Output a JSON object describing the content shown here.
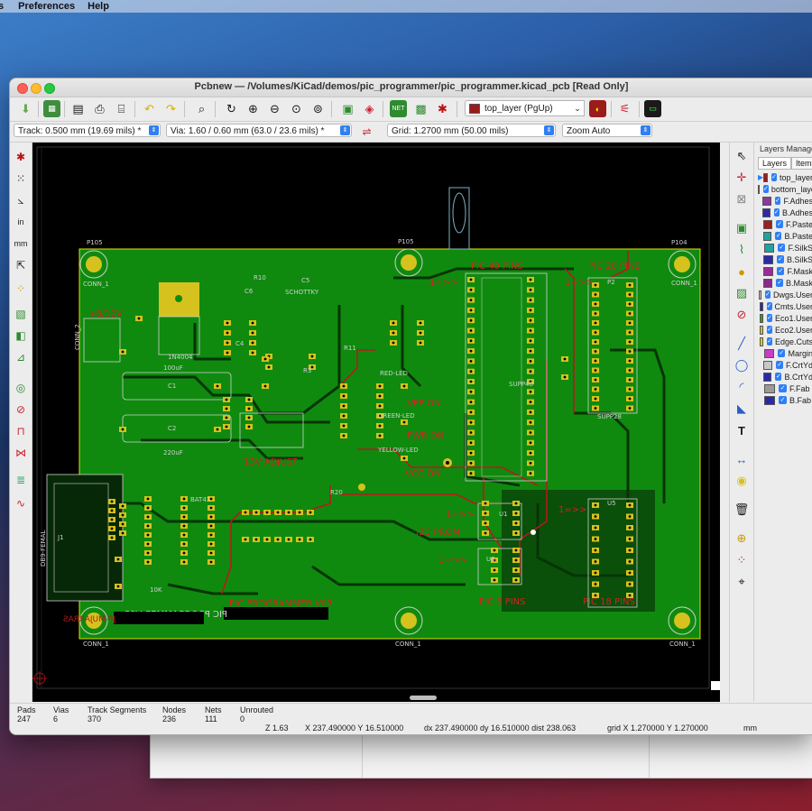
{
  "menubar": {
    "items": [
      "s",
      "Preferences",
      "Help"
    ]
  },
  "window": {
    "title": "Pcbnew — /Volumes/KiCad/demos/pic_programmer/pic_programmer.kicad_pcb [Read Only]"
  },
  "toolbar1": {
    "layer_select": "top_layer (PgUp)",
    "layer_color": "#9b1b1b"
  },
  "toolbar2": {
    "track": "Track: 0.500 mm (19.69 mils) *",
    "via": "Via: 1.60 / 0.60 mm (63.0 / 23.6 mils) *",
    "grid": "Grid: 1.2700 mm (50.00 mils)",
    "zoom": "Zoom Auto"
  },
  "layers_panel": {
    "title": "Layers Manager",
    "tab_layers": "Layers",
    "tab_items": "Items",
    "rows": [
      {
        "name": "top_layer",
        "color": "#9b1b1b",
        "active": true
      },
      {
        "name": "bottom_layer",
        "color": "#2e9e2e",
        "active": false
      },
      {
        "name": "F.Adhes",
        "color": "#8a3a9a",
        "active": false
      },
      {
        "name": "B.Adhes",
        "color": "#2a2aa8",
        "active": false
      },
      {
        "name": "F.Paste",
        "color": "#a01e1e",
        "active": false
      },
      {
        "name": "B.Paste",
        "color": "#1ea3a3",
        "active": false
      },
      {
        "name": "F.SilkS",
        "color": "#1ea3a3",
        "active": false
      },
      {
        "name": "B.SilkS",
        "color": "#2a2aa8",
        "active": false
      },
      {
        "name": "F.Mask",
        "color": "#9a2a9a",
        "active": false
      },
      {
        "name": "B.Mask",
        "color": "#8a2a8a",
        "active": false
      },
      {
        "name": "Dwgs.User",
        "color": "#c8c8c8",
        "active": false
      },
      {
        "name": "Cmts.User",
        "color": "#2a2aa8",
        "active": false
      },
      {
        "name": "Eco1.User",
        "color": "#2e9e2e",
        "active": false
      },
      {
        "name": "Eco2.User",
        "color": "#d6c21e",
        "active": false
      },
      {
        "name": "Edge.Cuts",
        "color": "#d6d61e",
        "active": false
      },
      {
        "name": "Margin",
        "color": "#c83cc8",
        "active": false
      },
      {
        "name": "F.CrtYd",
        "color": "#c8c8c8",
        "active": false
      },
      {
        "name": "B.CrtYd",
        "color": "#2a2aa8",
        "active": false
      },
      {
        "name": "F.Fab",
        "color": "#9a9a9a",
        "active": false
      },
      {
        "name": "B.Fab",
        "color": "#2a2aa8",
        "active": false
      }
    ]
  },
  "statusbar": {
    "stats": [
      {
        "label": "Pads",
        "value": "247"
      },
      {
        "label": "Vias",
        "value": "6"
      },
      {
        "label": "Track Segments",
        "value": "370"
      },
      {
        "label": "Nodes",
        "value": "236"
      },
      {
        "label": "Nets",
        "value": "111"
      },
      {
        "label": "Unrouted",
        "value": "0"
      }
    ],
    "zoom": "Z 1.63",
    "xy": "X 237.490000  Y 16.510000",
    "delta": "dx 237.490000  dy 16.510000  dist 238.063",
    "grid": "grid X 1.270000  Y 1.270000",
    "units": "mm"
  },
  "pcb": {
    "board_color": "#0f8a0f",
    "labels": {
      "p105a": "P105",
      "p105b": "P105",
      "p104": "P104",
      "conn1": "CONN_1",
      "conn1b": "CONN_1",
      "conn1c": "CONN_1",
      "conn1d": "CONN_1",
      "conn1e": "CONN_1",
      "power": "+8/12V",
      "conn2": "CONN_2",
      "pic40": "PIC 40 PINS",
      "pic28": "PIC 28 PINS",
      "arrow1": "1=>>",
      "arrow2": "1=>>",
      "arrow3": "1=>>",
      "arrow4": "1=>>",
      "arrow5": "1=>>",
      "vpp": "VPP ON",
      "pwr": "PWR ON",
      "vcc": "VCC ON",
      "adjust": "13V ADJUST",
      "i2c": "I2C PROM",
      "pic8": "PIC 8 PINS",
      "pic18": "PIC 18 PINS",
      "title": "PIC PROGRAMMER V03",
      "title_mirror": "PIC PROGRAMMER V03",
      "jp": "JP-MUJARRAS",
      "db9": "DB9-FEMAL",
      "supp40": "SUPP40",
      "supp28": "SUPP28",
      "j1": "J1",
      "u1": "U1",
      "u5": "U5",
      "u6": "U6",
      "p2": "P2",
      "c1": "C1",
      "c2": "C2",
      "cap1": "100uF",
      "cap2": "220uF",
      "diode": "1N4004",
      "schottky": "SCHOTTKY",
      "bat43": "BAT43",
      "red": "RED-LED",
      "green": "GREEN-LED",
      "yellow": "YELLOW-LED",
      "r10": "R10",
      "c6": "C6",
      "c5": "C5",
      "r11": "R11",
      "r20": "R20",
      "r10k": "10K",
      "pins8": "PIC 8 PINS",
      "p18": "PIC 18 PINS",
      "r3": "R3",
      "c4": "C4"
    }
  }
}
